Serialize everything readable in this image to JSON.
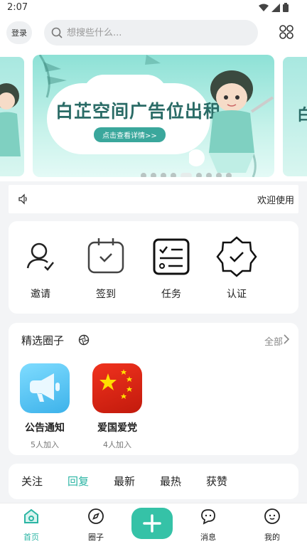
{
  "status": {
    "time": "2:07"
  },
  "header": {
    "login_label": "登录",
    "search_placeholder": "想搜些什么..."
  },
  "banner": {
    "title": "白芷空间广告位出租",
    "cta_label": "点击查看详情>>",
    "side_text": "白芷",
    "dot_count": 9,
    "active_dot": 4
  },
  "notice": {
    "text": "欢迎使用"
  },
  "shortcuts": [
    {
      "label": "邀请",
      "icon": "invite-icon"
    },
    {
      "label": "签到",
      "icon": "checkin-calendar-icon"
    },
    {
      "label": "任务",
      "icon": "task-list-icon"
    },
    {
      "label": "认证",
      "icon": "verified-badge-icon"
    }
  ],
  "circles": {
    "title": "精选圈子",
    "all_label": "全部",
    "items": [
      {
        "name": "公告通知",
        "count": "5人加入",
        "icon": "megaphone-icon",
        "color": "#5ec8f0"
      },
      {
        "name": "爱国爱党",
        "count": "4人加入",
        "icon": "china-flag-icon",
        "color": "#de2910"
      }
    ]
  },
  "feed_tabs": [
    {
      "label": "关注",
      "active": false
    },
    {
      "label": "回复",
      "active": true
    },
    {
      "label": "最新",
      "active": false
    },
    {
      "label": "最热",
      "active": false
    },
    {
      "label": "获赞",
      "active": false
    }
  ],
  "bottom_nav": [
    {
      "label": "首页",
      "icon": "home-icon",
      "active": true
    },
    {
      "label": "圈子",
      "icon": "compass-icon",
      "active": false
    },
    {
      "label": "",
      "icon": "plus-icon",
      "active": false
    },
    {
      "label": "消息",
      "icon": "message-icon",
      "active": false
    },
    {
      "label": "我的",
      "icon": "profile-icon",
      "active": false
    }
  ],
  "colors": {
    "accent": "#35c2a7",
    "accent_text": "#2bb5a4",
    "banner_bg": "#8de1d6",
    "page_bg": "#f3f4f6"
  }
}
